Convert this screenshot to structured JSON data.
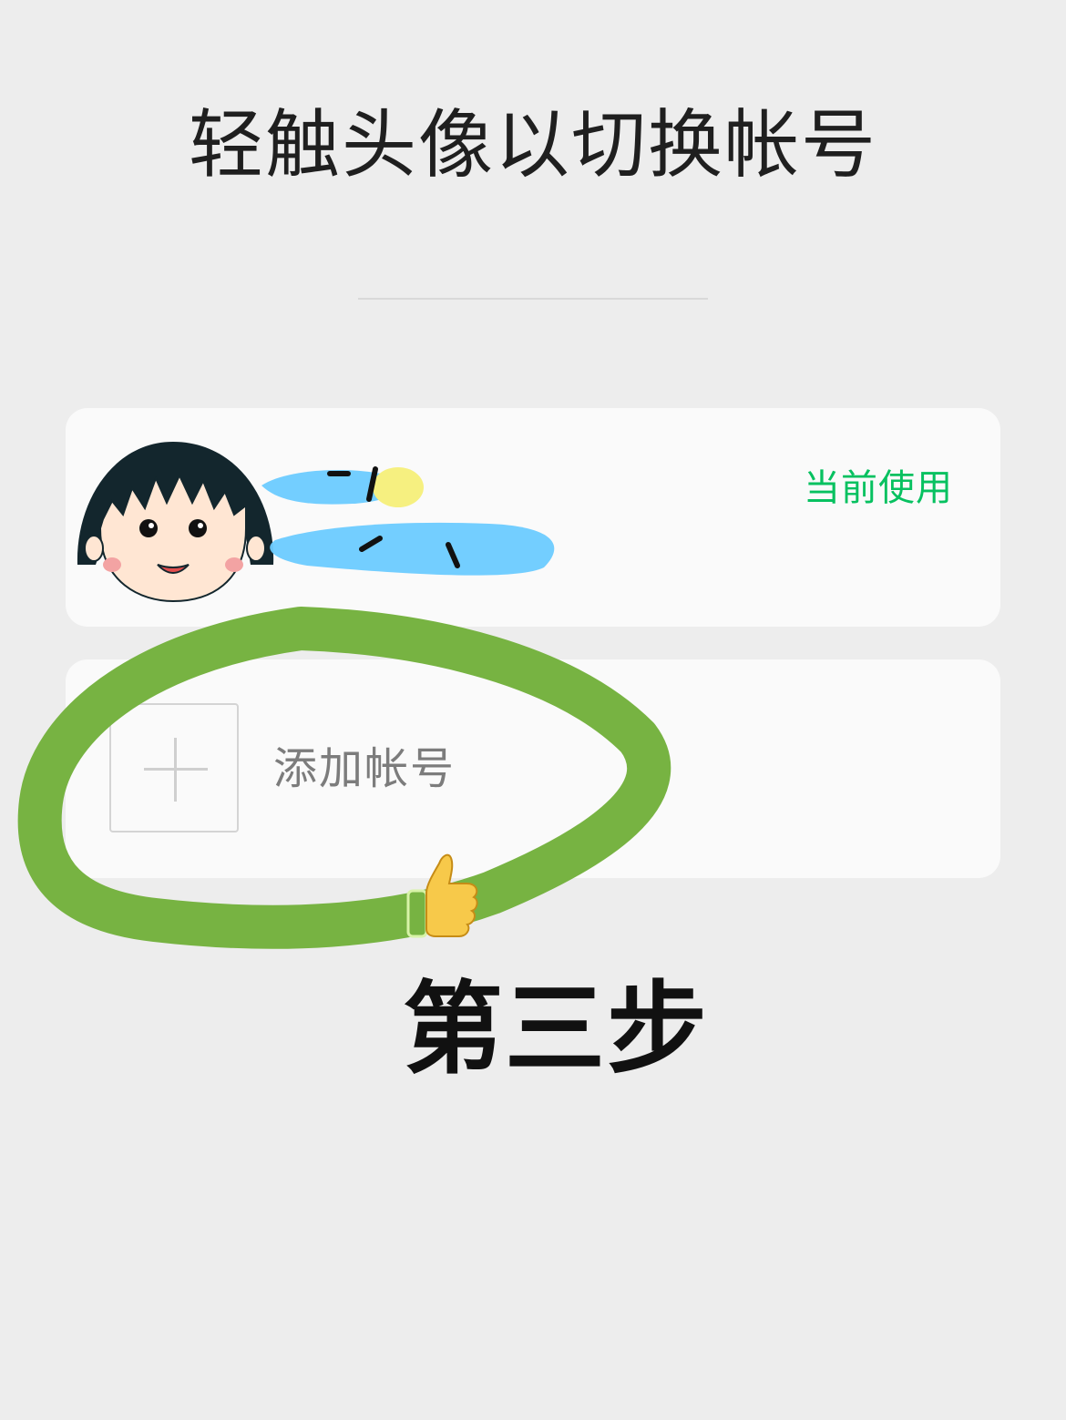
{
  "header": {
    "title": "轻触头像以切换帐号"
  },
  "accounts": {
    "current": {
      "avatar_icon": "cartoon-girl-avatar-icon",
      "status_label": "当前使用",
      "status_color": "#07c160"
    },
    "add": {
      "icon": "plus-icon",
      "label": "添加帐号"
    }
  },
  "annotations": {
    "highlight_color": "#77b342",
    "thumb_icon": "thumbs-up-icon",
    "step_label": "第三步"
  }
}
